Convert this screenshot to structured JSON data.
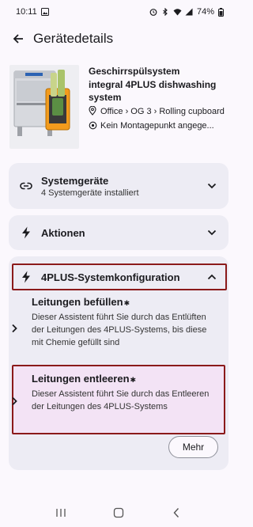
{
  "status_bar": {
    "time": "10:11",
    "battery": "74%"
  },
  "header": {
    "title": "Gerätedetails"
  },
  "device": {
    "name": "Geschirrspülsystem",
    "model": "integral 4PLUS dishwashing system",
    "location": "Office › OG 3 › Rolling cupboard",
    "mounting": "Kein Montagepunkt angege..."
  },
  "sections": {
    "systemgeraete": {
      "title": "Systemgeräte",
      "subtitle": "4 Systemgeräte installiert"
    },
    "aktionen": {
      "title": "Aktionen"
    },
    "konfiguration": {
      "title": "4PLUS-Systemkonfiguration",
      "items": [
        {
          "title": "Leitungen befüllen",
          "description": "Dieser Assistent führt Sie durch das Entlüften der Leitungen des 4PLUS-Systems, bis diese mit Chemie gefüllt sind"
        },
        {
          "title": "Leitungen entleeren",
          "description": "Dieser Assistent führt Sie durch das Entleeren der Leitungen des 4PLUS-Systems"
        }
      ],
      "more_label": "Mehr"
    }
  },
  "icons": {
    "bluetooth": "bluetooth-icon",
    "chevron": "chevron-right-icon"
  }
}
